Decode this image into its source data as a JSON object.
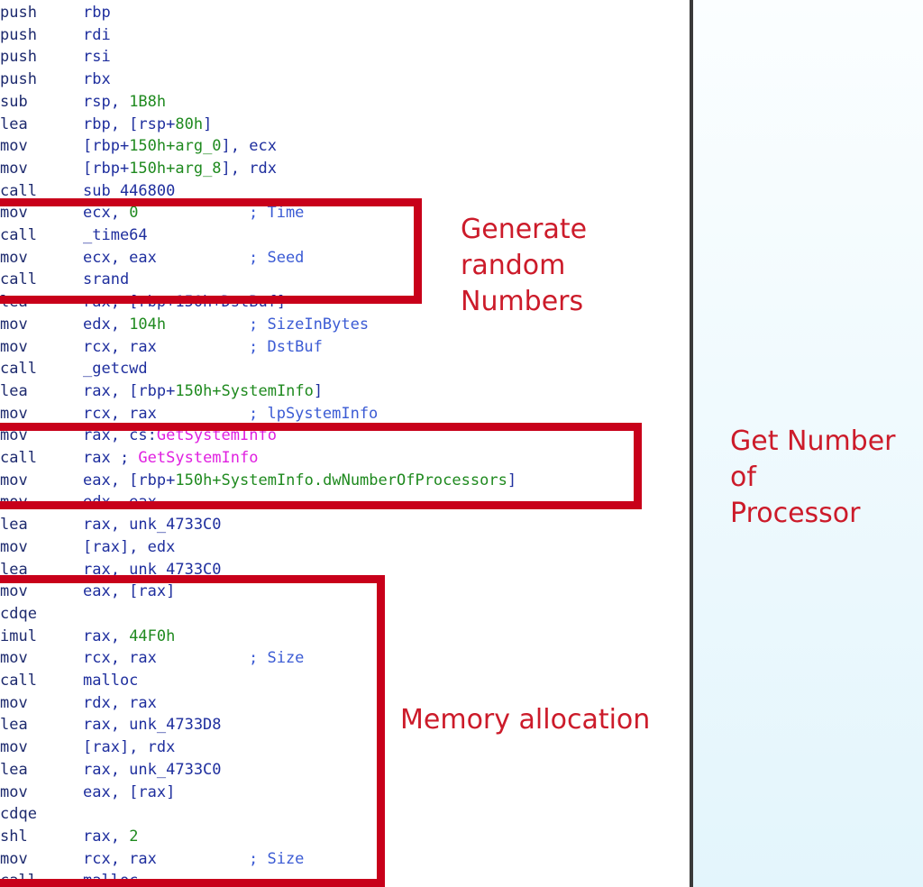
{
  "code_lines": [
    {
      "mn": "push",
      "parts": [
        {
          "t": "rbp"
        }
      ],
      "comment": ""
    },
    {
      "mn": "push",
      "parts": [
        {
          "t": "rdi"
        }
      ],
      "comment": ""
    },
    {
      "mn": "push",
      "parts": [
        {
          "t": "rsi"
        }
      ],
      "comment": ""
    },
    {
      "mn": "push",
      "parts": [
        {
          "t": "rbx"
        }
      ],
      "comment": ""
    },
    {
      "mn": "sub",
      "parts": [
        {
          "t": "rsp, "
        },
        {
          "t": "1B8h",
          "c": "num"
        }
      ],
      "comment": ""
    },
    {
      "mn": "lea",
      "parts": [
        {
          "t": "rbp, [rsp+"
        },
        {
          "t": "80h",
          "c": "num"
        },
        {
          "t": "]"
        }
      ],
      "comment": ""
    },
    {
      "mn": "mov",
      "parts": [
        {
          "t": "[rbp+"
        },
        {
          "t": "150h+arg_0",
          "c": "num"
        },
        {
          "t": "], ecx"
        }
      ],
      "comment": ""
    },
    {
      "mn": "mov",
      "parts": [
        {
          "t": "[rbp+"
        },
        {
          "t": "150h+arg_8",
          "c": "num"
        },
        {
          "t": "], rdx"
        }
      ],
      "comment": ""
    },
    {
      "mn": "call",
      "parts": [
        {
          "t": "sub_446800"
        }
      ],
      "comment": ""
    },
    {
      "mn": "mov",
      "parts": [
        {
          "t": "ecx, "
        },
        {
          "t": "0",
          "c": "num"
        }
      ],
      "comment": "; Time"
    },
    {
      "mn": "call",
      "parts": [
        {
          "t": "_time64"
        }
      ],
      "comment": ""
    },
    {
      "mn": "mov",
      "parts": [
        {
          "t": "ecx, eax"
        }
      ],
      "comment": "; Seed"
    },
    {
      "mn": "call",
      "parts": [
        {
          "t": "srand"
        }
      ],
      "comment": ""
    },
    {
      "mn": "lea",
      "parts": [
        {
          "t": "rax, [rbp+150h+DstBuf]"
        }
      ],
      "comment": ""
    },
    {
      "mn": "mov",
      "parts": [
        {
          "t": "edx, "
        },
        {
          "t": "104h",
          "c": "num"
        }
      ],
      "comment": "; SizeInBytes"
    },
    {
      "mn": "mov",
      "parts": [
        {
          "t": "rcx, rax"
        }
      ],
      "comment": "; DstBuf"
    },
    {
      "mn": "call",
      "parts": [
        {
          "t": "_getcwd"
        }
      ],
      "comment": ""
    },
    {
      "mn": "lea",
      "parts": [
        {
          "t": "rax, [rbp+"
        },
        {
          "t": "150h+SystemInfo",
          "c": "num"
        },
        {
          "t": "]"
        }
      ],
      "comment": ""
    },
    {
      "mn": "mov",
      "parts": [
        {
          "t": "rcx, rax"
        }
      ],
      "comment": "; lpSystemInfo"
    },
    {
      "mn": "mov",
      "parts": [
        {
          "t": "rax, cs:"
        },
        {
          "t": "GetSystemInfo",
          "c": "imp"
        }
      ],
      "comment": ""
    },
    {
      "mn": "call",
      "parts": [
        {
          "t": "rax ; "
        },
        {
          "t": "GetSystemInfo",
          "c": "imp"
        }
      ],
      "comment": ""
    },
    {
      "mn": "mov",
      "parts": [
        {
          "t": "eax, [rbp+"
        },
        {
          "t": "150h+SystemInfo.dwNumberOfProcessors",
          "c": "num"
        },
        {
          "t": "]"
        }
      ],
      "comment": ""
    },
    {
      "mn": "mov",
      "parts": [
        {
          "t": "edx, eax"
        }
      ],
      "comment": ""
    },
    {
      "mn": "lea",
      "parts": [
        {
          "t": "rax, unk_4733C0"
        }
      ],
      "comment": ""
    },
    {
      "mn": "mov",
      "parts": [
        {
          "t": "[rax], edx"
        }
      ],
      "comment": ""
    },
    {
      "mn": "lea",
      "parts": [
        {
          "t": "rax, unk_4733C0"
        }
      ],
      "comment": ""
    },
    {
      "mn": "mov",
      "parts": [
        {
          "t": "eax, [rax]"
        }
      ],
      "comment": ""
    },
    {
      "mn": "cdqe",
      "parts": [],
      "comment": ""
    },
    {
      "mn": "imul",
      "parts": [
        {
          "t": "rax, "
        },
        {
          "t": "44F0h",
          "c": "num"
        }
      ],
      "comment": ""
    },
    {
      "mn": "mov",
      "parts": [
        {
          "t": "rcx, rax"
        }
      ],
      "comment": "; Size"
    },
    {
      "mn": "call",
      "parts": [
        {
          "t": "malloc"
        }
      ],
      "comment": ""
    },
    {
      "mn": "mov",
      "parts": [
        {
          "t": "rdx, rax"
        }
      ],
      "comment": ""
    },
    {
      "mn": "lea",
      "parts": [
        {
          "t": "rax, unk_4733D8"
        }
      ],
      "comment": ""
    },
    {
      "mn": "mov",
      "parts": [
        {
          "t": "[rax], rdx"
        }
      ],
      "comment": ""
    },
    {
      "mn": "lea",
      "parts": [
        {
          "t": "rax, unk_4733C0"
        }
      ],
      "comment": ""
    },
    {
      "mn": "mov",
      "parts": [
        {
          "t": "eax, [rax]"
        }
      ],
      "comment": ""
    },
    {
      "mn": "cdqe",
      "parts": [],
      "comment": ""
    },
    {
      "mn": "shl",
      "parts": [
        {
          "t": "rax, "
        },
        {
          "t": "2",
          "c": "num"
        }
      ],
      "comment": ""
    },
    {
      "mn": "mov",
      "parts": [
        {
          "t": "rcx, rax"
        }
      ],
      "comment": "; Size"
    },
    {
      "mn": "call",
      "parts": [
        {
          "t": "malloc"
        }
      ],
      "comment": ""
    }
  ],
  "annotations": {
    "generate_random": "Generate\nrandom\nNumbers",
    "get_processors": "Get Number\nof\nProcessor",
    "memory_allocation": "Memory allocation"
  },
  "colors": {
    "highlight_box": "#c8001a",
    "annotation_text": "#cc1b2a",
    "immediate": "#1f8a1f",
    "import_name": "#e020e0",
    "comment": "#3b5bd4"
  }
}
